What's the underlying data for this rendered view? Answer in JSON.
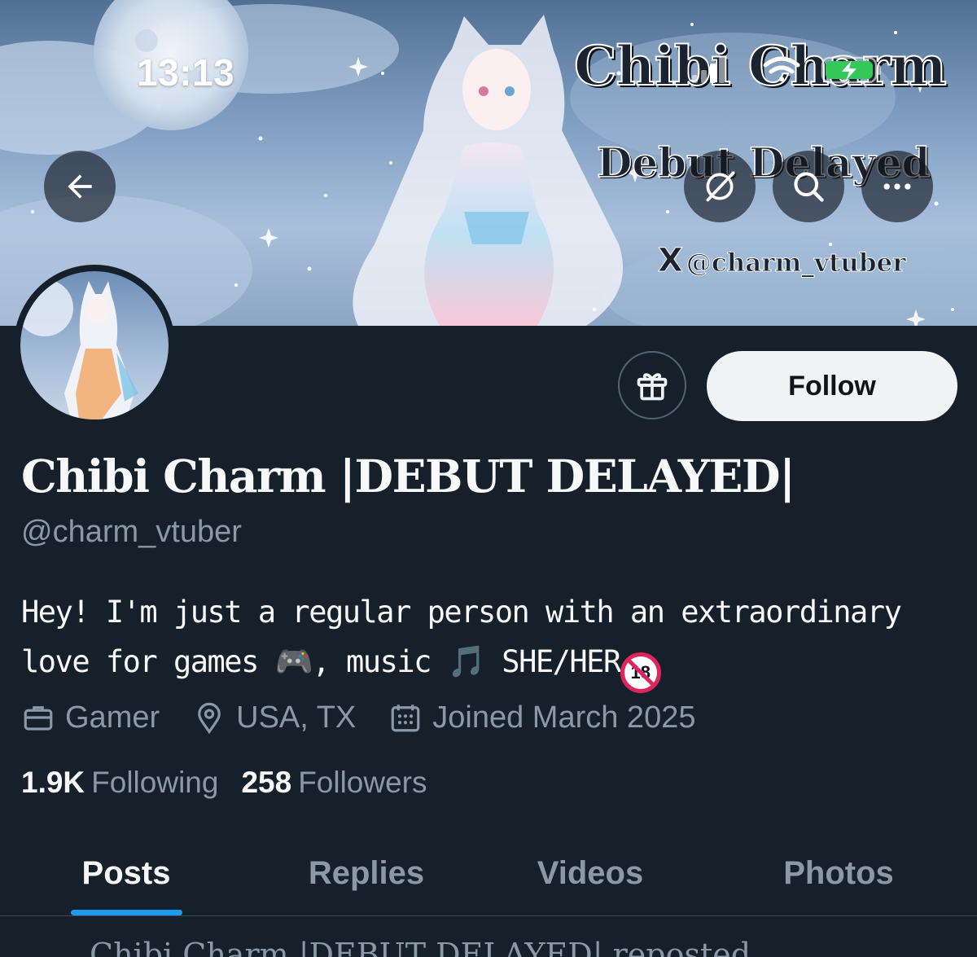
{
  "status_bar": {
    "time": "13:13",
    "wifi_icon": "wifi-icon",
    "battery_icon": "battery-charging-icon",
    "signal_icon": "cellular-signal-icon"
  },
  "banner": {
    "title": "Chibi Charm",
    "subtitle": "Debut Delayed",
    "handle": "@charm_vtuber",
    "x_logo": "X"
  },
  "header_buttons": {
    "back_icon": "arrow-left-icon",
    "grok_icon": "grok-icon",
    "search_icon": "search-icon",
    "more_icon": "more-dots-icon"
  },
  "profile": {
    "display_name": "Chibi Charm |DEBUT DELAYED|",
    "handle": "@charm_vtuber",
    "bio_line1": "Hey! I'm just a regular person with an extraordinary",
    "bio_line2_prefix": "love for games ",
    "bio_line2_mid": ", music ",
    "bio_line2_suffix": " SHE/HER",
    "bio_emoji_game": "🎮",
    "bio_emoji_music": "🎵",
    "bio_emoji_no18": "18",
    "profession": "Gamer",
    "location": "USA, TX",
    "joined": "Joined March 2025",
    "following_count": "1.9K",
    "following_label": "Following",
    "followers_count": "258",
    "followers_label": "Followers"
  },
  "actions": {
    "gift_icon": "gift-icon",
    "follow_label": "Follow"
  },
  "tabs": [
    {
      "label": "Posts",
      "active": true
    },
    {
      "label": "Replies",
      "active": false
    },
    {
      "label": "Videos",
      "active": false
    },
    {
      "label": "Photos",
      "active": false
    }
  ],
  "next_row_text": "Chibi Charm |DEBUT DELAYED| reposted",
  "colors": {
    "background": "#15202b",
    "accent": "#1d9bf0",
    "text_primary": "#f7f9f9",
    "text_secondary": "#8b98a5",
    "follow_bg": "#eff3f4"
  }
}
